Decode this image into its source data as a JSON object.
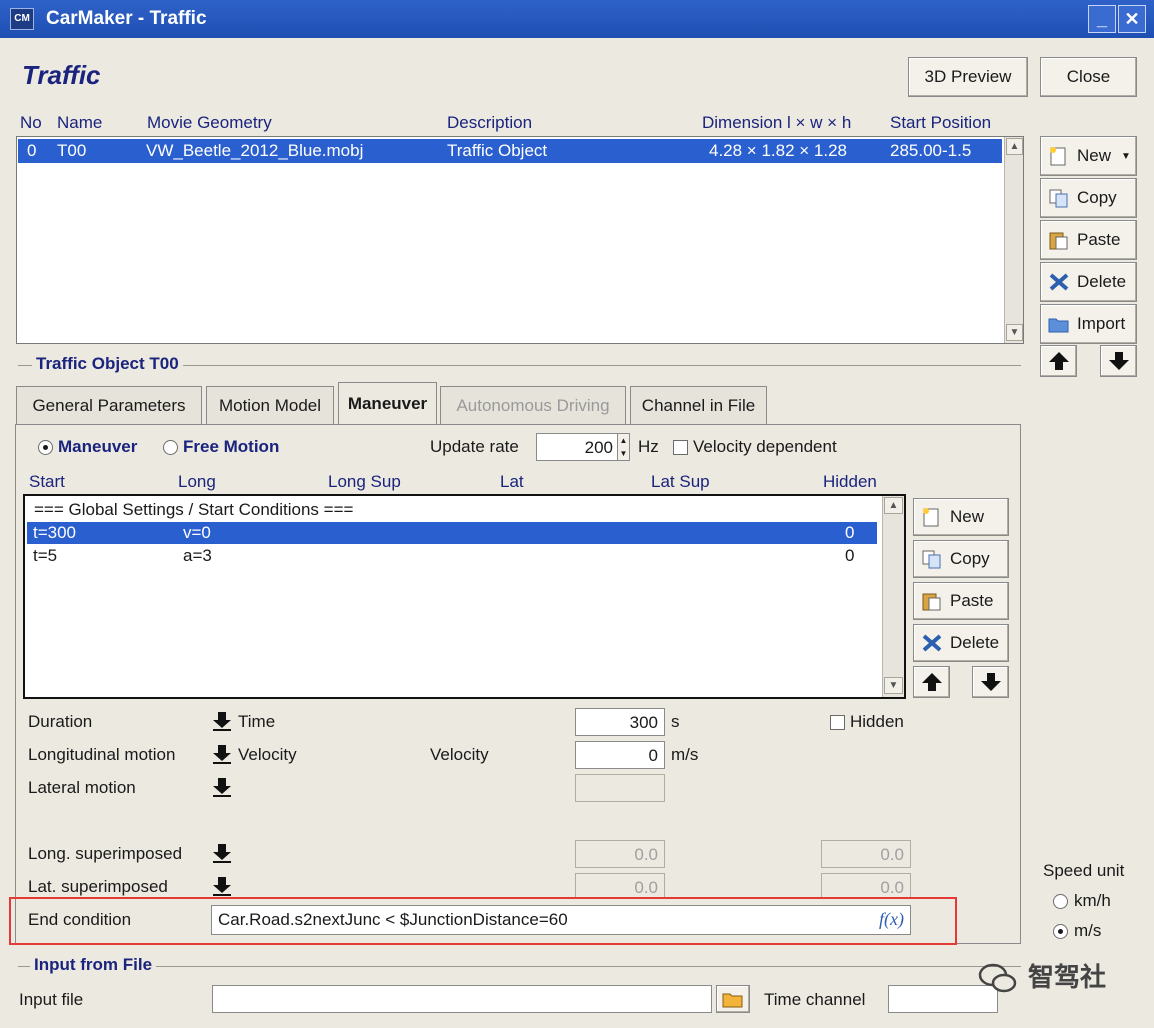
{
  "window": {
    "app_icon": "CM",
    "title": "CarMaker - Traffic",
    "minimize": "_",
    "close": "✕"
  },
  "page_title": "Traffic",
  "top_buttons": {
    "preview": "3D Preview",
    "close": "Close"
  },
  "object_table": {
    "headers": [
      "No",
      "Name",
      "Movie Geometry",
      "Description",
      "Dimension l × w × h",
      "Start Position"
    ],
    "rows": [
      {
        "no": "0",
        "name": "T00",
        "geometry": "VW_Beetle_2012_Blue.mobj",
        "description": "Traffic Object",
        "dimension": "4.28 × 1.82 × 1.28",
        "start": "285.00-1.5"
      }
    ]
  },
  "side_buttons": {
    "new": "New",
    "copy": "Copy",
    "paste": "Paste",
    "delete": "Delete",
    "import": "Import"
  },
  "section_object": "Traffic Object T00",
  "tabs": [
    "General Parameters",
    "Motion Model",
    "Maneuver",
    "Autonomous Driving",
    "Channel in File"
  ],
  "maneuver": {
    "radio_maneuver": "Maneuver",
    "radio_free": "Free Motion",
    "update_rate_label": "Update rate",
    "update_rate_value": "200",
    "update_rate_unit": "Hz",
    "velocity_dependent": "Velocity dependent",
    "columns": [
      "Start",
      "Long",
      "Long Sup",
      "Lat",
      "Lat Sup",
      "Hidden"
    ],
    "global_row": "=== Global Settings / Start Conditions ===",
    "rows": [
      {
        "start": "t=300",
        "long": "v=0",
        "hidden": "0"
      },
      {
        "start": "t=5",
        "long": "a=3",
        "hidden": "0"
      }
    ],
    "buttons": {
      "new": "New",
      "copy": "Copy",
      "paste": "Paste",
      "delete": "Delete"
    }
  },
  "params": {
    "duration_label": "Duration",
    "duration_mode": "Time",
    "duration_value": "300",
    "duration_unit": "s",
    "hidden_label": "Hidden",
    "long_label": "Longitudinal motion",
    "long_mode": "Velocity",
    "velocity_label": "Velocity",
    "velocity_value": "0",
    "velocity_unit": "m/s",
    "lat_label": "Lateral motion",
    "long_sup_label": "Long. superimposed",
    "long_sup_v1": "0.0",
    "long_sup_v2": "0.0",
    "lat_sup_label": "Lat. superimposed",
    "lat_sup_v1": "0.0",
    "lat_sup_v2": "0.0",
    "end_label": "End condition",
    "end_value": "Car.Road.s2nextJunc < $JunctionDistance=60",
    "fx": "f(x)"
  },
  "speed_unit": {
    "label": "Speed unit",
    "kmh": "km/h",
    "ms": "m/s"
  },
  "input_file": {
    "section": "Input from File",
    "file_label": "Input file",
    "time_label": "Time channel"
  },
  "watermark": "智驾社",
  "colors": {
    "selection": "#2a5fcf",
    "title_bar": "#2f62c8",
    "highlight_frame": "#e53935"
  }
}
